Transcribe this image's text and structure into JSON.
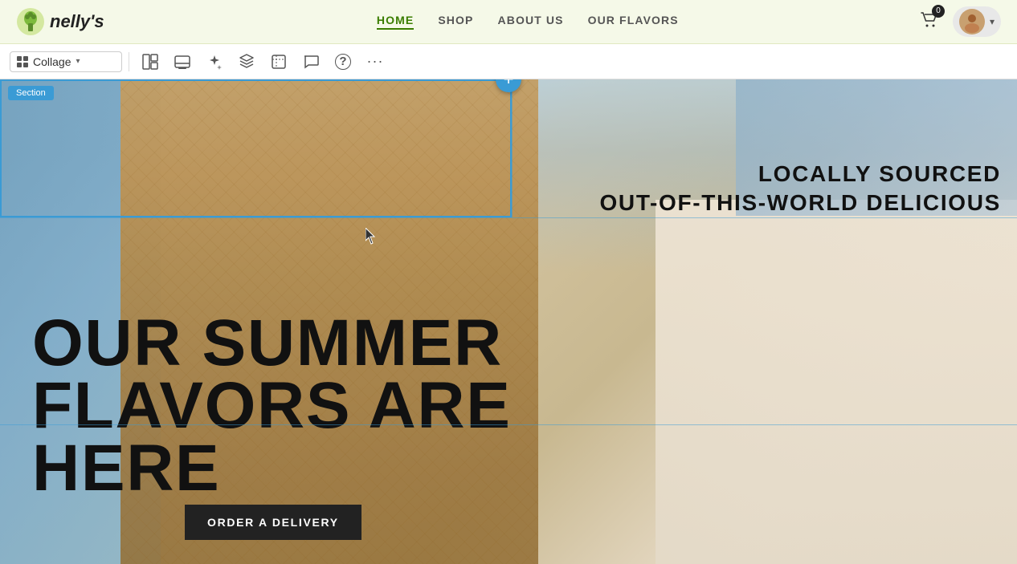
{
  "navbar": {
    "logo_text": "nelly's",
    "nav_links": [
      {
        "label": "HOME",
        "active": true
      },
      {
        "label": "SHOP",
        "active": false
      },
      {
        "label": "ABOUT US",
        "active": false
      },
      {
        "label": "OUR FLAVORS",
        "active": false
      }
    ],
    "cart_count": "0",
    "user_chevron": "▾"
  },
  "editor_toolbar": {
    "collage_label": "Collage",
    "grid_icon": "⊞",
    "layout_icon": "⊟",
    "preview_icon": "▭",
    "ai_icon": "✦",
    "layers_icon": "◈",
    "crop_icon": "⊡",
    "comment_icon": "💬",
    "help_icon": "?",
    "more_icon": "···",
    "chevron": "▾"
  },
  "editor": {
    "section_badge": "Section",
    "add_section_label": "+"
  },
  "hero": {
    "tagline_1": "LOCALLY SOURCED",
    "tagline_2": "OUT-OF-THIS-WORLD DELICIOUS",
    "headline_1": "OUR SUMMER",
    "headline_2": "FLAVORS ARE",
    "headline_3": "HERE",
    "cta_button": "ORDER A DELIVERY"
  }
}
